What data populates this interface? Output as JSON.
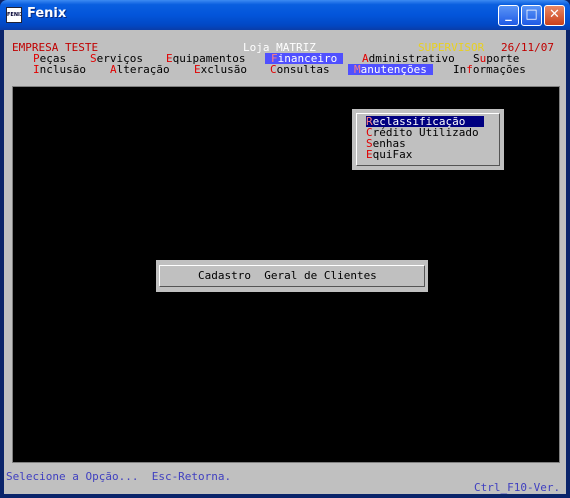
{
  "window": {
    "title": "Fenix",
    "icon_label": "FENIX"
  },
  "header": {
    "company": "EMPRESA TESTE",
    "store": "Loja MATRIZ",
    "user": "SUPERVISOR",
    "date": "26/11/07"
  },
  "menu_row1": [
    {
      "hot": "P",
      "rest": "eças"
    },
    {
      "hot": "S",
      "rest": "erviços"
    },
    {
      "hot": "E",
      "rest": "quipamentos"
    },
    {
      "hot": "F",
      "rest": "inanceiro"
    },
    {
      "hot": "A",
      "rest": "dministrativo"
    },
    {
      "pre": "S",
      "hot": "u",
      "rest": "porte"
    }
  ],
  "menu_row2": [
    {
      "hot": "I",
      "rest": "nclusão"
    },
    {
      "hot": "A",
      "rest": "lteração"
    },
    {
      "hot": "E",
      "rest": "xclusão"
    },
    {
      "hot": "C",
      "rest": "onsultas"
    },
    {
      "hot": "M",
      "rest": "anutenções"
    },
    {
      "pre": "In",
      "hot": "f",
      "rest": "ormações"
    }
  ],
  "dropdown": {
    "items": [
      {
        "hot": "R",
        "rest": "eclassificação"
      },
      {
        "hot": "C",
        "rest": "rédito Utilizado"
      },
      {
        "hot": "S",
        "rest": "enhas"
      },
      {
        "hot": "E",
        "rest": "quiFax"
      }
    ]
  },
  "dialog": {
    "text": "Cadastro  Geral de Clientes"
  },
  "status": {
    "left": "Selecione a Opção...  Esc-Retorna.",
    "right": "Ctrl_F10-Ver."
  },
  "colors": {
    "highlight": "#5050FF",
    "selected": "#000080",
    "hotkey": "#E00000",
    "status_text": "#4040C0"
  }
}
